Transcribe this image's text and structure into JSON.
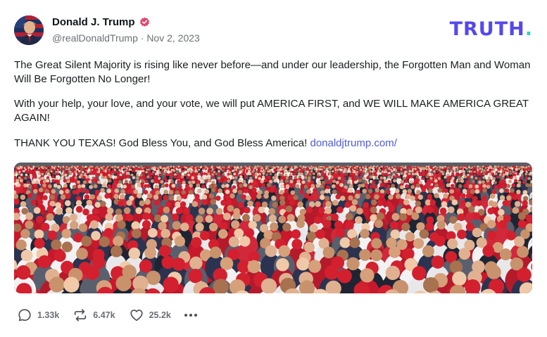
{
  "post": {
    "author": {
      "name": "Donald J. Trump",
      "handle": "@realDonaldTrump",
      "date": "Nov 2, 2023",
      "verified": true
    },
    "brand": {
      "logo_main": "TRUTH",
      "logo_dot": ".",
      "color": "#5448ee",
      "dot_color": "#2dd4bf"
    },
    "paragraphs": [
      "The Great Silent Majority is rising like never before—and under our leadership, the Forgotten Man and Woman Will Be Forgotten No Longer!",
      "With your help, your love, and your vote, we will put AMERICA FIRST, and WE WILL MAKE AMERICA GREAT AGAIN!",
      "THANK YOU TEXAS! God Bless You, and God Bless America!"
    ],
    "link_text": "donaldjtrump.com/",
    "media": {
      "icon": "crowd-photo"
    },
    "actions": {
      "replies": "1.33k",
      "retruths": "6.47k",
      "likes": "25.2k"
    }
  }
}
